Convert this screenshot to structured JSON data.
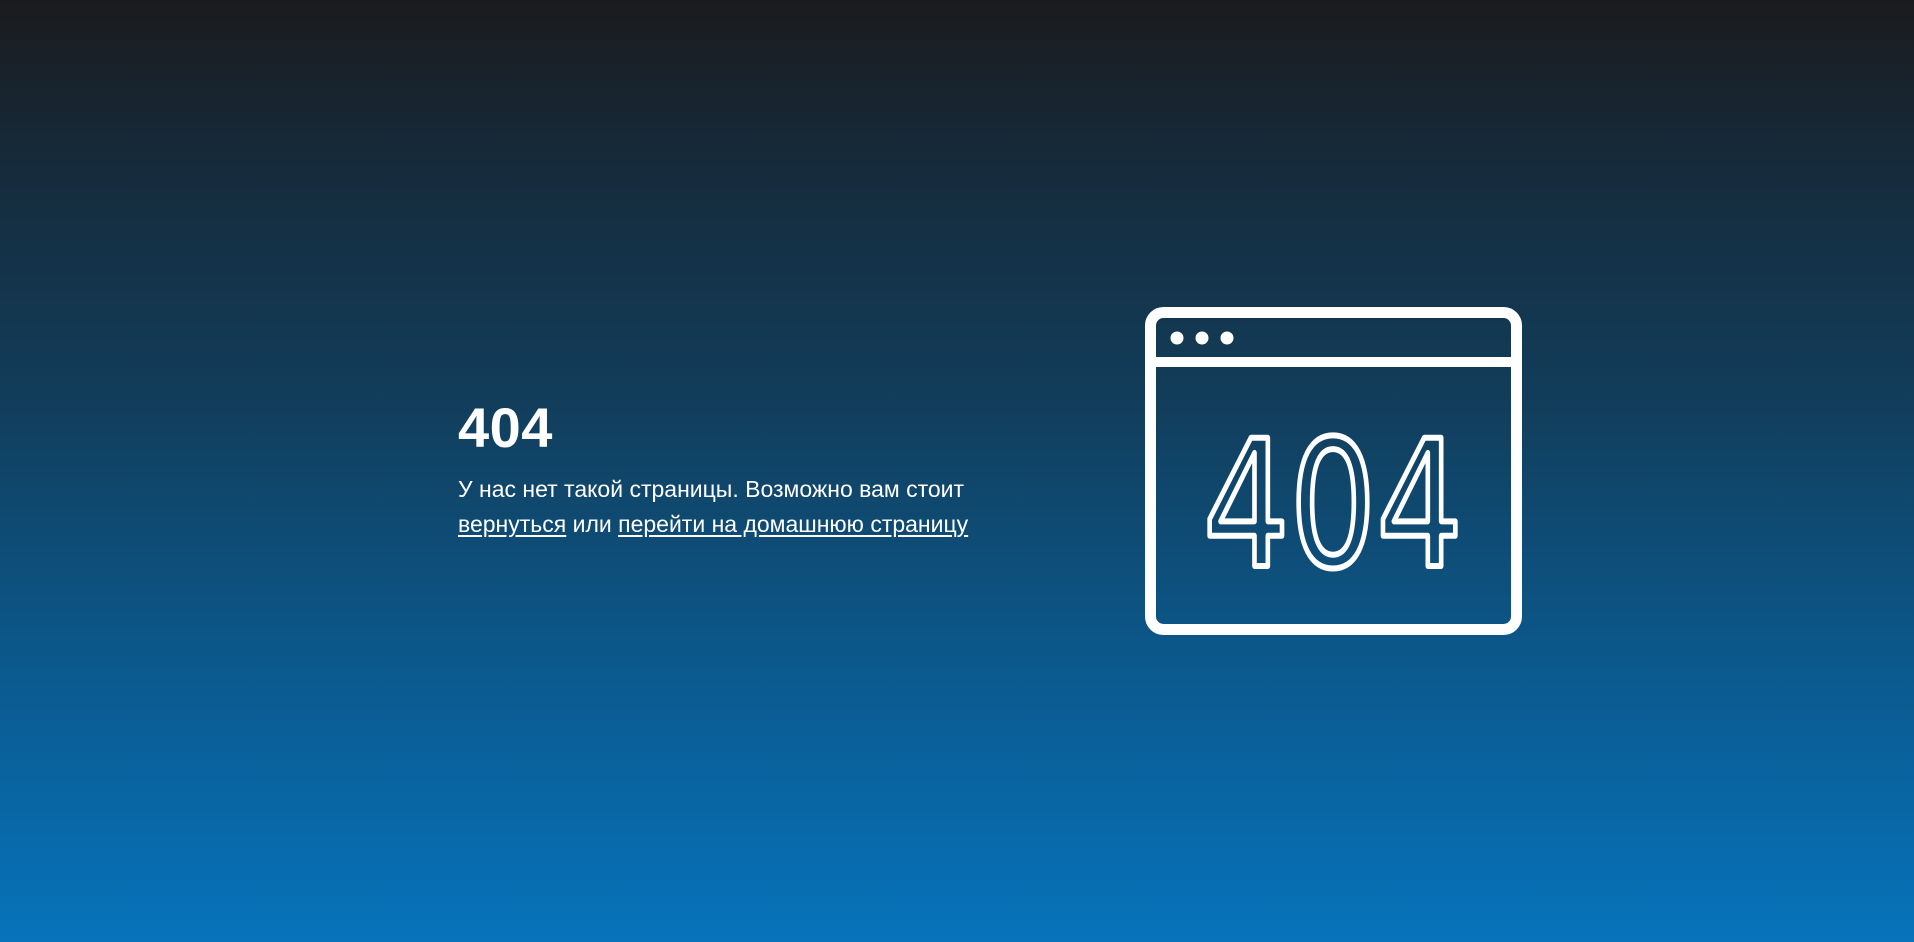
{
  "error": {
    "code": "404",
    "message_prefix": "У нас нет такой страницы. Возможно вам стоит",
    "back_link": "вернуться",
    "conjunction": "или",
    "home_link": "перейти на домашнюю страницу"
  },
  "illustration": {
    "icon": "browser-window-404-icon",
    "label": "404"
  },
  "colors": {
    "gradient_top": "#1b1b1d",
    "gradient_bottom": "#0773bb",
    "text": "#ffffff"
  }
}
